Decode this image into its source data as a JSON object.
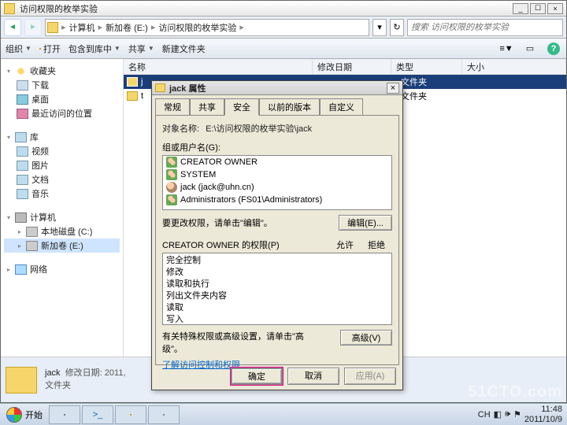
{
  "titlebar": {
    "title": "访问权限的枚举实验",
    "min": "_",
    "max": "☐",
    "close": "×"
  },
  "nav": {
    "crumbs": [
      "计算机",
      "新加卷 (E:)",
      "访问权限的枚举实验"
    ],
    "search_placeholder": "搜索 访问权限的枚举实验",
    "dropdown": "▾",
    "refresh": "↻"
  },
  "toolbar": {
    "organize": "组织",
    "open": "打开",
    "include": "包含到库中",
    "share": "共享",
    "newfolder": "新建文件夹"
  },
  "navpane": {
    "fav": "收藏夹",
    "down": "下载",
    "desk": "桌面",
    "recent": "最近访问的位置",
    "lib": "库",
    "video": "视频",
    "pic": "图片",
    "doc": "文档",
    "music": "音乐",
    "pc": "计算机",
    "cdrive": "本地磁盘 (C:)",
    "edrive": "新加卷 (E:)",
    "net": "网络"
  },
  "list": {
    "cols": {
      "name": "名称",
      "date": "修改日期",
      "type": "类型",
      "size": "大小"
    },
    "rows": [
      {
        "name": "j",
        "type": "文件夹"
      },
      {
        "name": "t",
        "type": "文件夹"
      }
    ]
  },
  "detail": {
    "name": "jack",
    "dateline": "修改日期: 2011,",
    "type": "文件夹"
  },
  "prop": {
    "title": "jack 属性",
    "close": "×",
    "tabs": {
      "general": "常规",
      "share": "共享",
      "security": "安全",
      "prev": "以前的版本",
      "custom": "自定义"
    },
    "obj_label": "对象名称:",
    "obj_val": "E:\\访问权限的枚举实验\\jack",
    "groups_label": "组或用户名(G):",
    "groups": [
      "CREATOR OWNER",
      "SYSTEM",
      "jack (jack@uhn.cn)",
      "Administrators (FS01\\Administrators)"
    ],
    "editline": "要更改权限，请单击\"编辑\"。",
    "edit_btn": "编辑(E)...",
    "perm_label": "CREATOR OWNER 的权限(P)",
    "allow": "允许",
    "deny": "拒绝",
    "perms": [
      "完全控制",
      "修改",
      "读取和执行",
      "列出文件夹内容",
      "读取",
      "写入"
    ],
    "adv_text": "有关特殊权限或高级设置，请单击\"高级\"。",
    "adv_btn": "高级(V)",
    "link": "了解访问控制和权限",
    "ok": "确定",
    "cancel": "取消",
    "apply": "应用(A)"
  },
  "taskbar": {
    "start": "开始",
    "ime": "CH",
    "time": "11:48",
    "date": "2011/10/9"
  },
  "watermark": "51CTO.com"
}
